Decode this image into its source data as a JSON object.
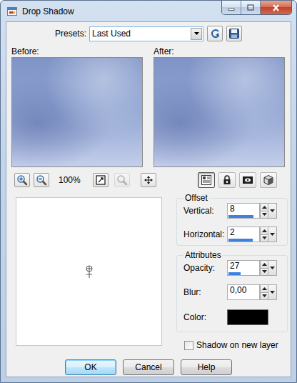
{
  "window": {
    "title": "Drop Shadow"
  },
  "presets": {
    "label": "Presets:",
    "value": "Last Used"
  },
  "previews": [
    {
      "label": "Before:"
    },
    {
      "label": "After:"
    }
  ],
  "preview_toolbar": {
    "zoom_level": "100%",
    "fit_disabled": false,
    "actual_size_disabled": true
  },
  "view_modes": [
    {
      "selected": true
    },
    {
      "selected": false
    },
    {
      "selected": false
    },
    {
      "selected": false
    }
  ],
  "offset": {
    "title": "Offset",
    "fields": [
      {
        "label": "Vertical:",
        "value": "8",
        "level": 0.84
      },
      {
        "label": "Horizontal:",
        "value": "2",
        "level": 0.8
      }
    ]
  },
  "attributes": {
    "title": "Attributes",
    "fields": [
      {
        "label": "Opacity:",
        "value": "27",
        "level": 0.4
      },
      {
        "label": "Blur:",
        "value": "0,00",
        "level": 0
      }
    ],
    "color": {
      "label": "Color:",
      "value": "#000000"
    }
  },
  "checkbox": {
    "label": "Shadow on new layer",
    "checked": false
  },
  "buttons": [
    {
      "label": "OK",
      "default": true
    },
    {
      "label": "Cancel",
      "default": false
    },
    {
      "label": "Help",
      "default": false
    }
  ]
}
